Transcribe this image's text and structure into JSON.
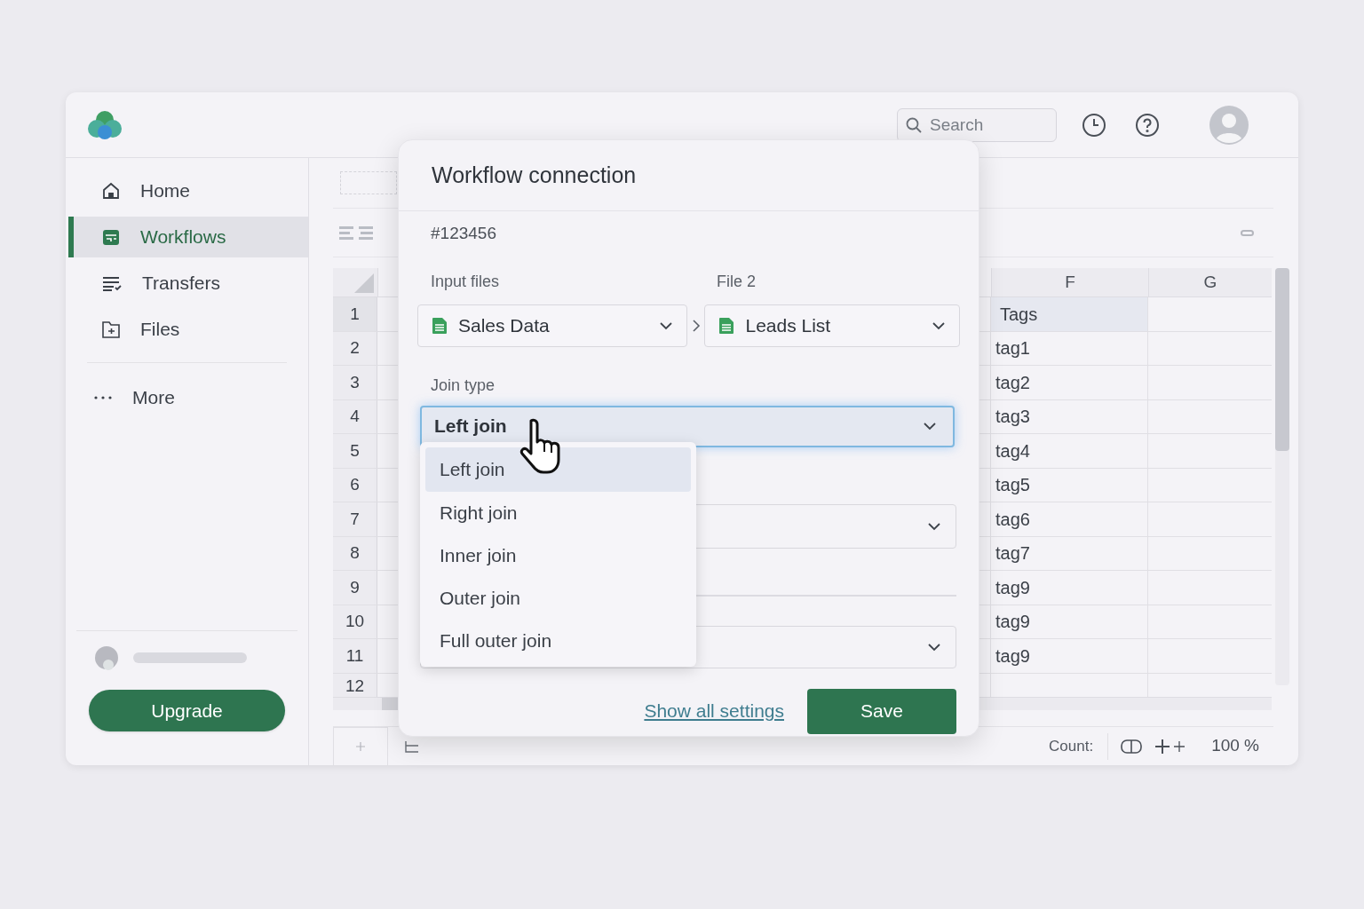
{
  "header": {
    "search": {
      "placeholder": "Search"
    }
  },
  "sidebar": {
    "items": [
      {
        "label": "Home",
        "kind": "home",
        "selected": false
      },
      {
        "label": "Workflows",
        "kind": "workflow",
        "selected": true
      },
      {
        "label": "Transfers",
        "kind": "transfers",
        "selected": false
      },
      {
        "label": "Files",
        "kind": "files",
        "selected": false
      }
    ],
    "more": "More",
    "upgrade": "Upgrade"
  },
  "sheet": {
    "columns": [
      "F",
      "G"
    ],
    "rows": [
      {
        "number": "1",
        "tags": "Tags",
        "selected": true
      },
      {
        "number": "2",
        "tags": "tag1",
        "selected": false
      },
      {
        "number": "3",
        "tags": "tag2",
        "selected": false
      },
      {
        "number": "4",
        "tags": "tag3",
        "selected": false
      },
      {
        "number": "5",
        "tags": "tag4",
        "selected": false
      },
      {
        "number": "6",
        "tags": "tag5",
        "selected": false
      },
      {
        "number": "7",
        "tags": "tag6",
        "selected": false
      },
      {
        "number": "8",
        "tags": "tag7",
        "selected": false
      },
      {
        "number": "9",
        "tags": "tag9",
        "selected": false
      },
      {
        "number": "10",
        "tags": "tag9",
        "selected": false
      },
      {
        "number": "11",
        "tags": "tag9",
        "selected": false
      },
      {
        "number": "12",
        "selected": false
      }
    ]
  },
  "status_bar": {
    "count": "Count:",
    "zoom": "100 %"
  },
  "dialog": {
    "title": "Workflow connection",
    "id": "#123456",
    "input_label": "Input files",
    "file2_label": "File 2",
    "file1": "Sales Data",
    "file2": "Leads List",
    "join_label": "Join type",
    "join_value": "Left join",
    "join_options": [
      {
        "label": "Left join",
        "selected": true
      },
      {
        "label": "Right join",
        "selected": false
      },
      {
        "label": "Inner join",
        "selected": false
      },
      {
        "label": "Outer join",
        "selected": false
      },
      {
        "label": "Full outer join",
        "selected": false
      }
    ],
    "link": "Show all settings",
    "save": "Save"
  }
}
